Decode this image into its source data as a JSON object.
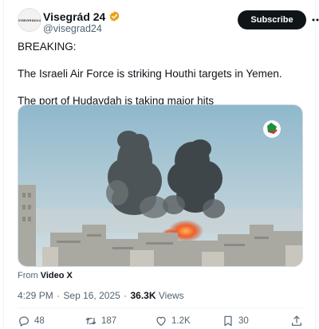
{
  "account": {
    "avatar_text": "VISEGRÁD24",
    "display_name": "Visegrád 24",
    "handle": "@visegrad24",
    "verified_color": "#e8a317"
  },
  "actions": {
    "subscribe_label": "Subscribe",
    "more_icon": "more-horizontal-icon"
  },
  "tweet": {
    "lines": [
      "BREAKING:",
      "The Israeli Air Force is striking Houthi targets in Yemen.",
      "The port of Hudaydah is taking major hits"
    ]
  },
  "media": {
    "type": "video",
    "description_icon": "channel-logo-icon",
    "from_prefix": "From",
    "from_source": "Video X"
  },
  "meta": {
    "time": "4:29 PM",
    "date": "Sep 16, 2025",
    "views_count": "36.3K",
    "views_label": "Views"
  },
  "engagement": {
    "replies": "48",
    "reposts": "187",
    "likes": "1.2K",
    "bookmarks": "30"
  },
  "colors": {
    "text_primary": "#0f1419",
    "text_secondary": "#536471",
    "button_dark": "#0f1419"
  }
}
